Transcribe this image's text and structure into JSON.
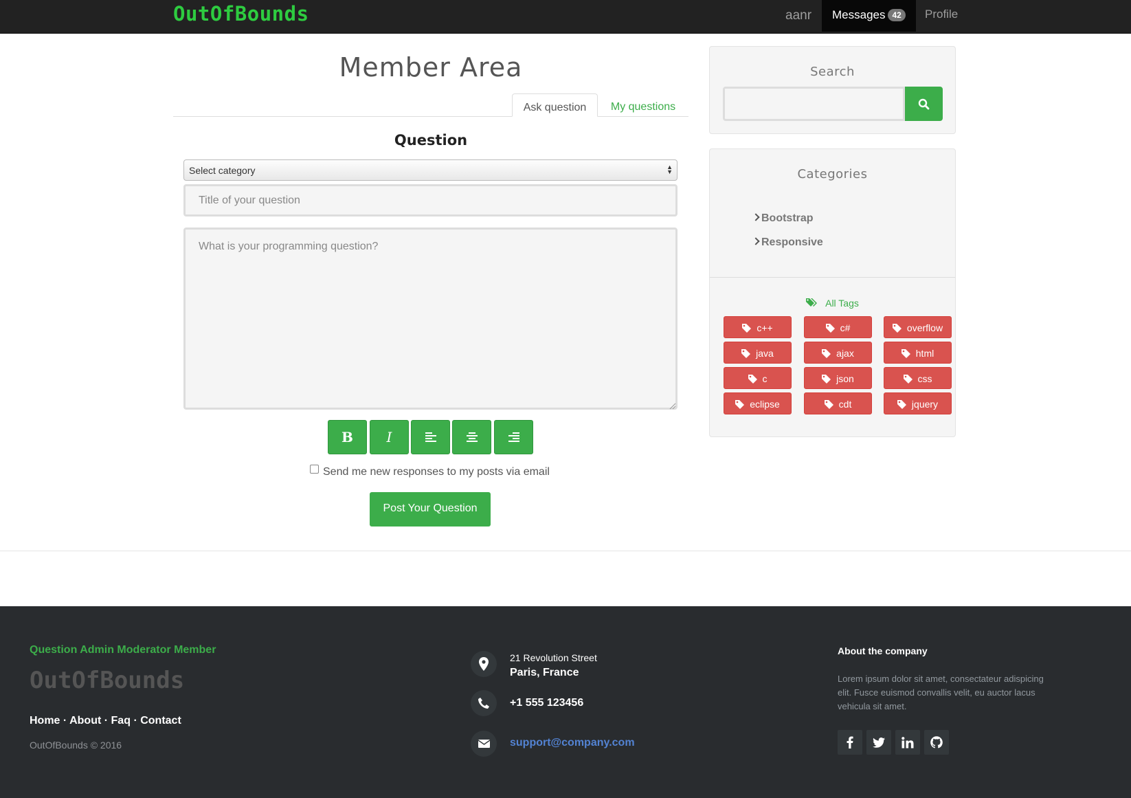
{
  "navbar": {
    "brand": "OutOfBounds",
    "user": "aanr",
    "messages_label": "Messages",
    "messages_count": "42",
    "profile_label": "Profile"
  },
  "main": {
    "title": "Member Area",
    "tabs": [
      {
        "label": "Ask question",
        "active": true
      },
      {
        "label": "My questions",
        "active": false
      }
    ],
    "form": {
      "heading": "Question",
      "category_select": "Select category",
      "title_placeholder": "Title of your question",
      "body_placeholder": "What is your programming question?",
      "format_buttons": [
        "bold",
        "italic",
        "align-left",
        "align-center",
        "align-right"
      ],
      "bold_glyph": "B",
      "italic_glyph": "I",
      "email_checkbox_label": "Send me new responses to my posts via email",
      "email_checkbox_checked": false,
      "submit_label": "Post Your Question"
    }
  },
  "sidebar": {
    "search": {
      "title": "Search",
      "value": ""
    },
    "categories": {
      "title": "Categories",
      "items": [
        "Bootstrap",
        "Responsive"
      ]
    },
    "tags": {
      "header": "All Tags",
      "items": [
        "c++",
        "c#",
        "overflow",
        "java",
        "ajax",
        "html",
        "c",
        "json",
        "css",
        "eclipse",
        "cdt",
        "jquery"
      ]
    }
  },
  "footer": {
    "roles": "Question Admin Moderator Member",
    "logo": "OutOfBounds",
    "links": [
      "Home",
      "About",
      "Faq",
      "Contact"
    ],
    "link_separator": "·",
    "copyright": "OutOfBounds © 2016",
    "address_line1": "21 Revolution Street",
    "address_line2": "Paris, France",
    "phone": "+1 555 123456",
    "email": "support@company.com",
    "about_title": "About the company",
    "about_text": "Lorem ipsum dolor sit amet, consectateur adispicing elit. Fusce euismod convallis velit, eu auctor lacus vehicula sit amet.",
    "social": [
      "facebook-icon",
      "twitter-icon",
      "linkedin-icon",
      "github-icon"
    ]
  },
  "colors": {
    "accent": "#3cad4a",
    "brand": "#2ecc40",
    "tag": "#d9534f",
    "navbar": "#222222",
    "footer": "#292c2f",
    "link": "#5383d3"
  }
}
